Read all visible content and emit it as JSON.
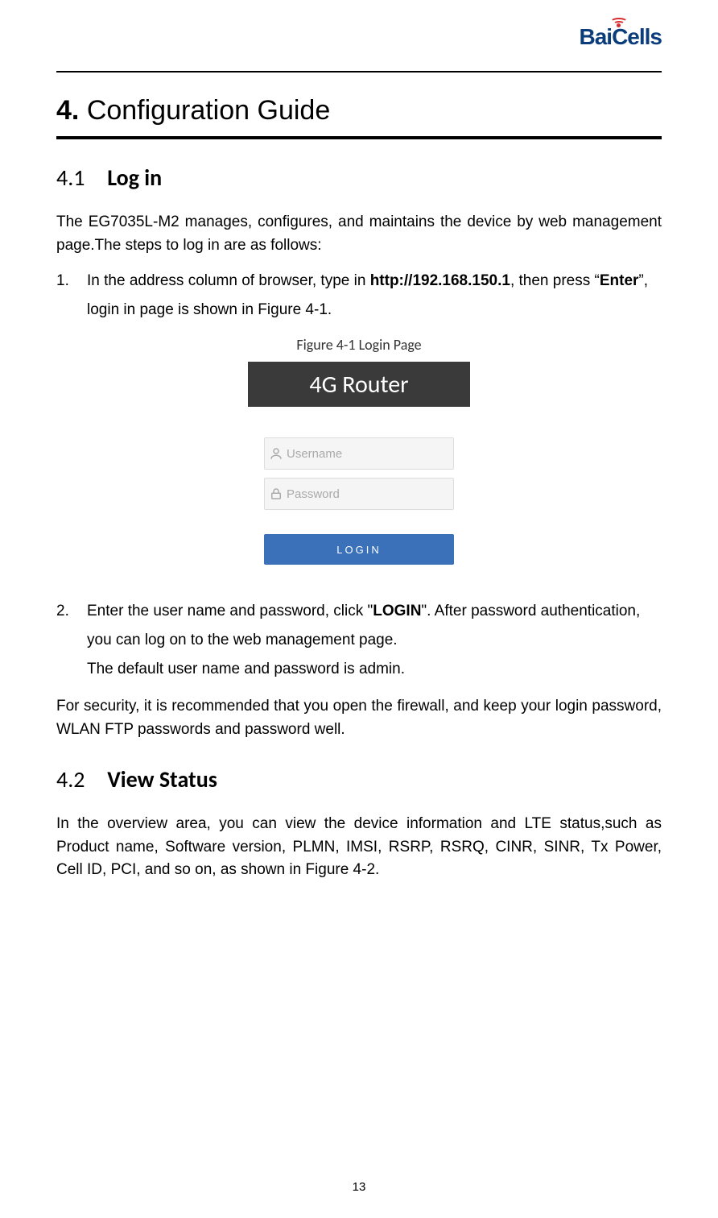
{
  "logo": {
    "part1": "Bai",
    "part2": "Cells"
  },
  "chapter": {
    "num": "4.",
    "title": "Configuration Guide"
  },
  "section1": {
    "num": "4.1",
    "title": "Log in",
    "intro": "The EG7035L-M2 manages, configures, and maintains the device by web management page.The steps to log in are as follows:",
    "step1_num": "1.",
    "step1_a": "In the address column of browser, type in ",
    "step1_url": "http://192.168.150.1",
    "step1_b": ", then press “",
    "step1_key": "Enter",
    "step1_c": "”, login in page is shown in Figure 4-1.",
    "figure_caption": "Figure 4-1 Login Page",
    "banner": "4G Router",
    "username_placeholder": "Username",
    "password_placeholder": "Password",
    "login_label": "LOGIN",
    "step2_num": "2.",
    "step2_a": "Enter the user name and password, click \"",
    "step2_key": "LOGIN",
    "step2_b": "\". After password authentication, you can log on to the web management page.",
    "step2_note": "The default user name and password is admin.",
    "security_note": "For security, it is recommended that you open the firewall, and keep your login password, WLAN FTP passwords and password well."
  },
  "section2": {
    "num": "4.2",
    "title": "View Status",
    "body": "In the overview area, you can view the device information and LTE status,such as Product name, Software version, PLMN, IMSI, RSRP, RSRQ, CINR, SINR, Tx Power, Cell ID, PCI, and so on, as shown in Figure 4-2."
  },
  "page_number": "13"
}
